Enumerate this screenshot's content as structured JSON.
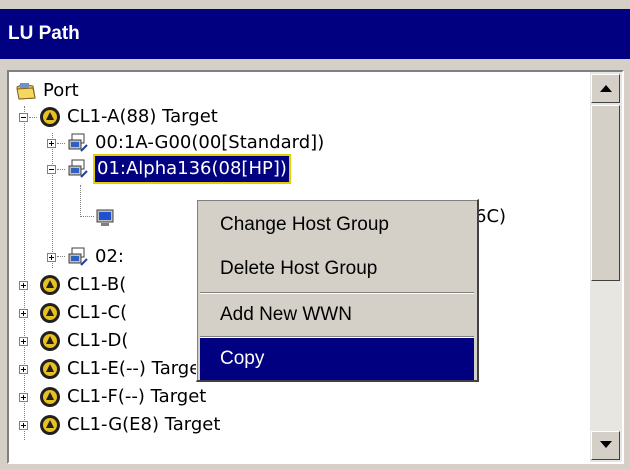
{
  "window": {
    "title": "LU Path"
  },
  "tree": {
    "nodes": [
      {
        "id": "port",
        "label": "Port",
        "icon": "folder-icon",
        "expander": "none"
      },
      {
        "id": "cl1a",
        "label": "CL1-A(88) Target",
        "icon": "port-icon",
        "expander": "minus"
      },
      {
        "id": "hg00",
        "label": "00:1A-G00(00[Standard])",
        "icon": "host-group-icon",
        "expander": "plus"
      },
      {
        "id": "hg01",
        "label": "01:Alpha136(08[HP])",
        "icon": "host-group-icon",
        "expander": "minus",
        "selected": true
      },
      {
        "id": "wwn",
        "label": "6C)",
        "icon": "host-icon",
        "expander": "none"
      },
      {
        "id": "hg02",
        "label": "02:",
        "icon": "host-group-icon",
        "expander": "plus"
      },
      {
        "id": "cl1b",
        "label": "CL1-B(",
        "icon": "port-icon",
        "expander": "plus"
      },
      {
        "id": "cl1c",
        "label": "CL1-C(",
        "icon": "port-icon",
        "expander": "plus"
      },
      {
        "id": "cl1d",
        "label": "CL1-D(",
        "icon": "port-icon",
        "expander": "plus"
      },
      {
        "id": "cl1e",
        "label": "CL1-E(--) Target",
        "icon": "port-icon",
        "expander": "plus"
      },
      {
        "id": "cl1f",
        "label": "CL1-F(--) Target",
        "icon": "port-icon",
        "expander": "plus"
      },
      {
        "id": "cl1g",
        "label": "CL1-G(E8) Target",
        "icon": "port-icon",
        "expander": "plus"
      }
    ]
  },
  "context_menu": {
    "items": [
      {
        "label": "Change Host Group"
      },
      {
        "label": "Delete Host Group"
      },
      {
        "label": "Add New WWN"
      },
      {
        "label": "Copy",
        "active": true
      }
    ]
  },
  "colors": {
    "title_bar": "#000080",
    "selection": "#000080",
    "selection_outline": "#e0d000",
    "panel_bg": "#d4d0c8"
  }
}
